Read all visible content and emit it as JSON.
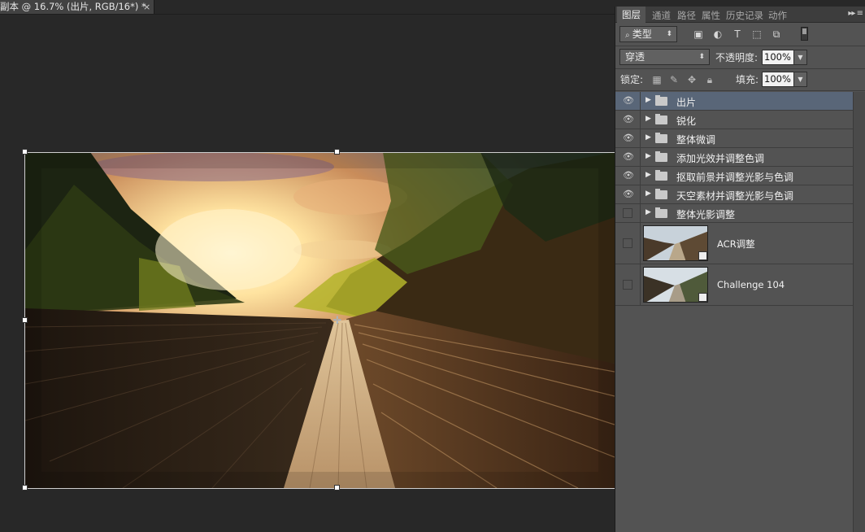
{
  "document": {
    "tab_title": "副本 @ 16.7% (出片, RGB/16*) *",
    "close_glyph": "×"
  },
  "layers_panel": {
    "tabs": [
      "图层",
      "通道",
      "路径",
      "属性",
      "历史记录",
      "动作"
    ],
    "menu_glyph": "▸▸ ≡",
    "filter_kind": "类型",
    "filter_icons": [
      "image-filter-icon",
      "adjustment-filter-icon",
      "type-filter-icon",
      "shape-filter-icon",
      "smart-object-filter-icon"
    ],
    "blend_mode": "穿透",
    "opacity_label": "不透明度:",
    "opacity_value": "100%",
    "lock_label": "锁定:",
    "fill_label": "填充:",
    "fill_value": "100%",
    "layers": [
      {
        "name": "出片",
        "type": "group",
        "visible": true,
        "selected": true
      },
      {
        "name": "锐化",
        "type": "group",
        "visible": true,
        "selected": false
      },
      {
        "name": "整体微调",
        "type": "group",
        "visible": true,
        "selected": false
      },
      {
        "name": "添加光效并调整色调",
        "type": "group",
        "visible": true,
        "selected": false
      },
      {
        "name": "抠取前景并调整光影与色调",
        "type": "group",
        "visible": true,
        "selected": false
      },
      {
        "name": "天空素材并调整光影与色调",
        "type": "group",
        "visible": true,
        "selected": false
      },
      {
        "name": "整体光影调整",
        "type": "group",
        "visible": false,
        "selected": false
      },
      {
        "name": "ACR调整",
        "type": "smart-object",
        "visible": false,
        "selected": false
      },
      {
        "name": "Challenge 104",
        "type": "smart-object",
        "visible": false,
        "selected": false
      }
    ]
  },
  "colors": {
    "workspace": "#282828",
    "panel": "#535353",
    "selected_layer": "#596678"
  }
}
